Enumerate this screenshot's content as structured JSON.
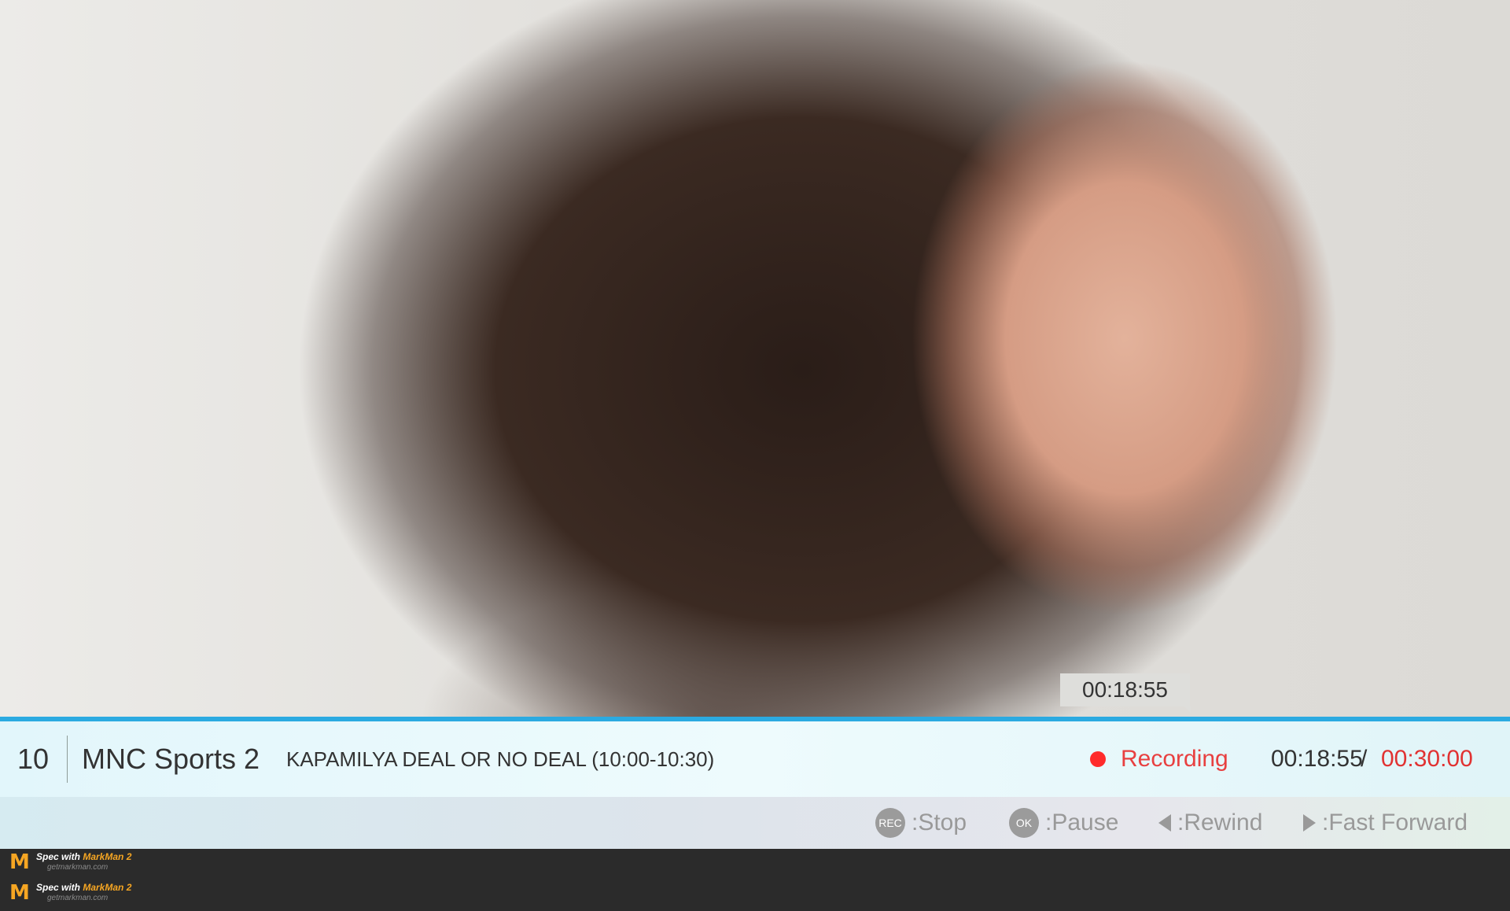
{
  "colors": {
    "progress": "#2baae1",
    "text": "#333333",
    "separator": "#8e9c98",
    "recording_red": "#e84040",
    "controls": "#999999",
    "tooltip_bg": "#dededb"
  },
  "progress": {
    "tooltip_time": "00:18:55",
    "fraction_played": 0.63
  },
  "channel": {
    "number": "10",
    "name": "MNC Sports 2"
  },
  "program": {
    "title": "KAPAMILYA DEAL OR NO DEAL (10:00-10:30)"
  },
  "recording": {
    "label": "Recording"
  },
  "time": {
    "current": "00:18:55",
    "separator": "/",
    "total": "00:30:00"
  },
  "controls": {
    "stop": {
      "badge": "REC",
      "label": ":Stop"
    },
    "pause": {
      "badge": "OK",
      "label": ":Pause"
    },
    "rewind": {
      "icon": "rewind-icon",
      "label": ":Rewind"
    },
    "forward": {
      "icon": "fast-forward-icon",
      "label": ":Fast Forward"
    }
  },
  "watermark": {
    "line1_prefix": "Spec with ",
    "line1_brand": "MarkMan 2",
    "line2": "getmarkman.com"
  }
}
